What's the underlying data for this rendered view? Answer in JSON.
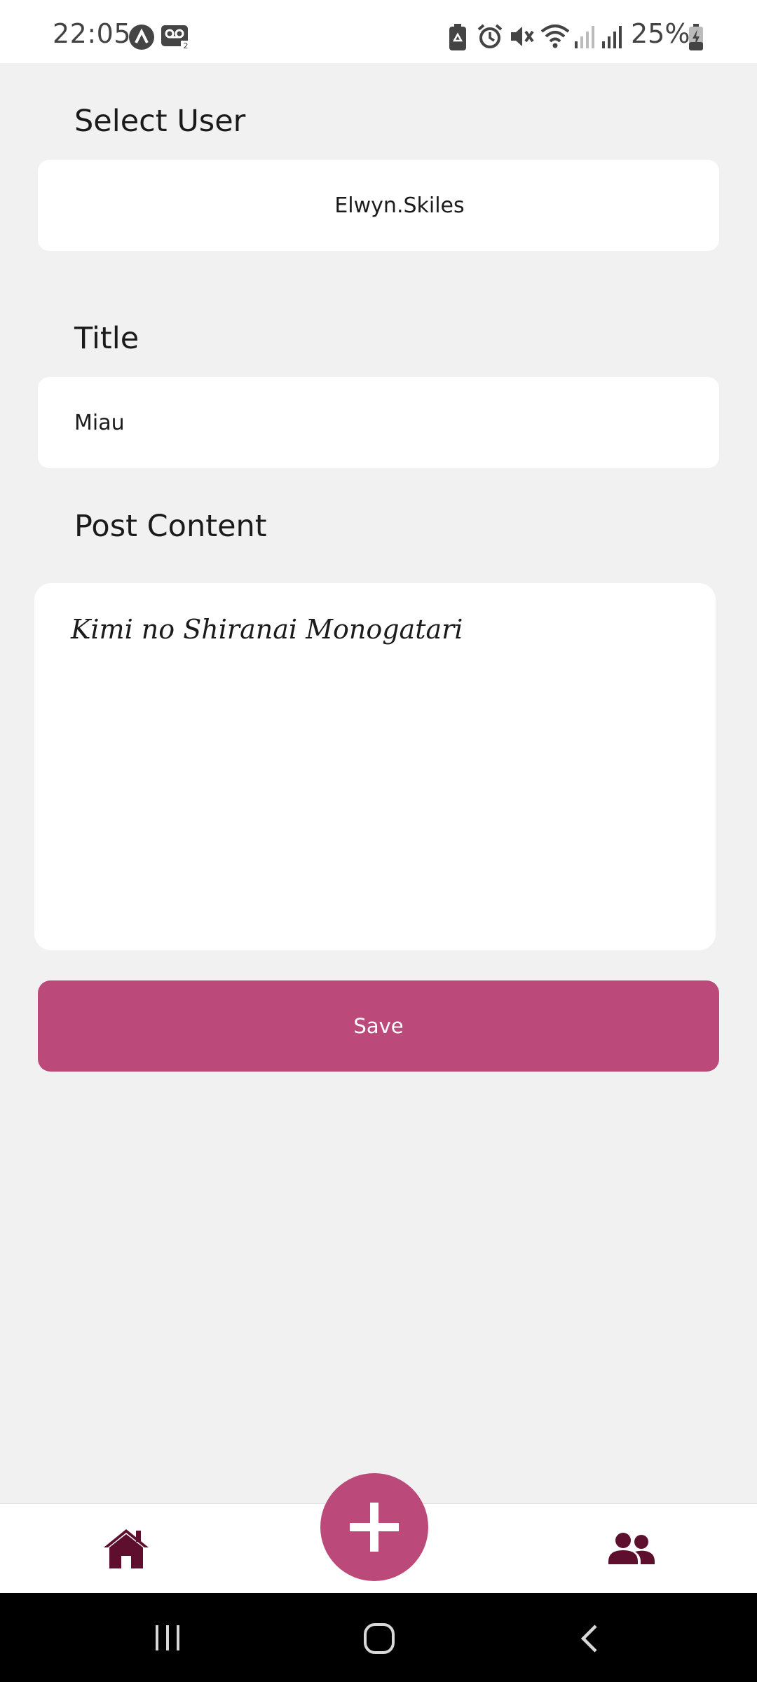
{
  "status_bar": {
    "time": "22:05",
    "battery": "25%",
    "icons": [
      "assistant-icon",
      "voicemail-icon",
      "recycle-icon",
      "alarm-icon",
      "mute-icon",
      "wifi-icon",
      "signal-icon",
      "signal-icon",
      "battery-charging-icon"
    ]
  },
  "form": {
    "select_user_label": "Select User",
    "selected_user": "Elwyn.Skiles",
    "title_label": "Title",
    "title_value": "Miau",
    "content_label": "Post Content",
    "content_value": "Kimi no Shiranai Monogatari",
    "save_label": "Save"
  },
  "bottom_nav": {
    "items": [
      "home-icon",
      "add-icon",
      "users-icon"
    ]
  },
  "colors": {
    "accent": "#bb4a7a",
    "nav_icon": "#5e0f2e",
    "background": "#f1f1f1"
  }
}
